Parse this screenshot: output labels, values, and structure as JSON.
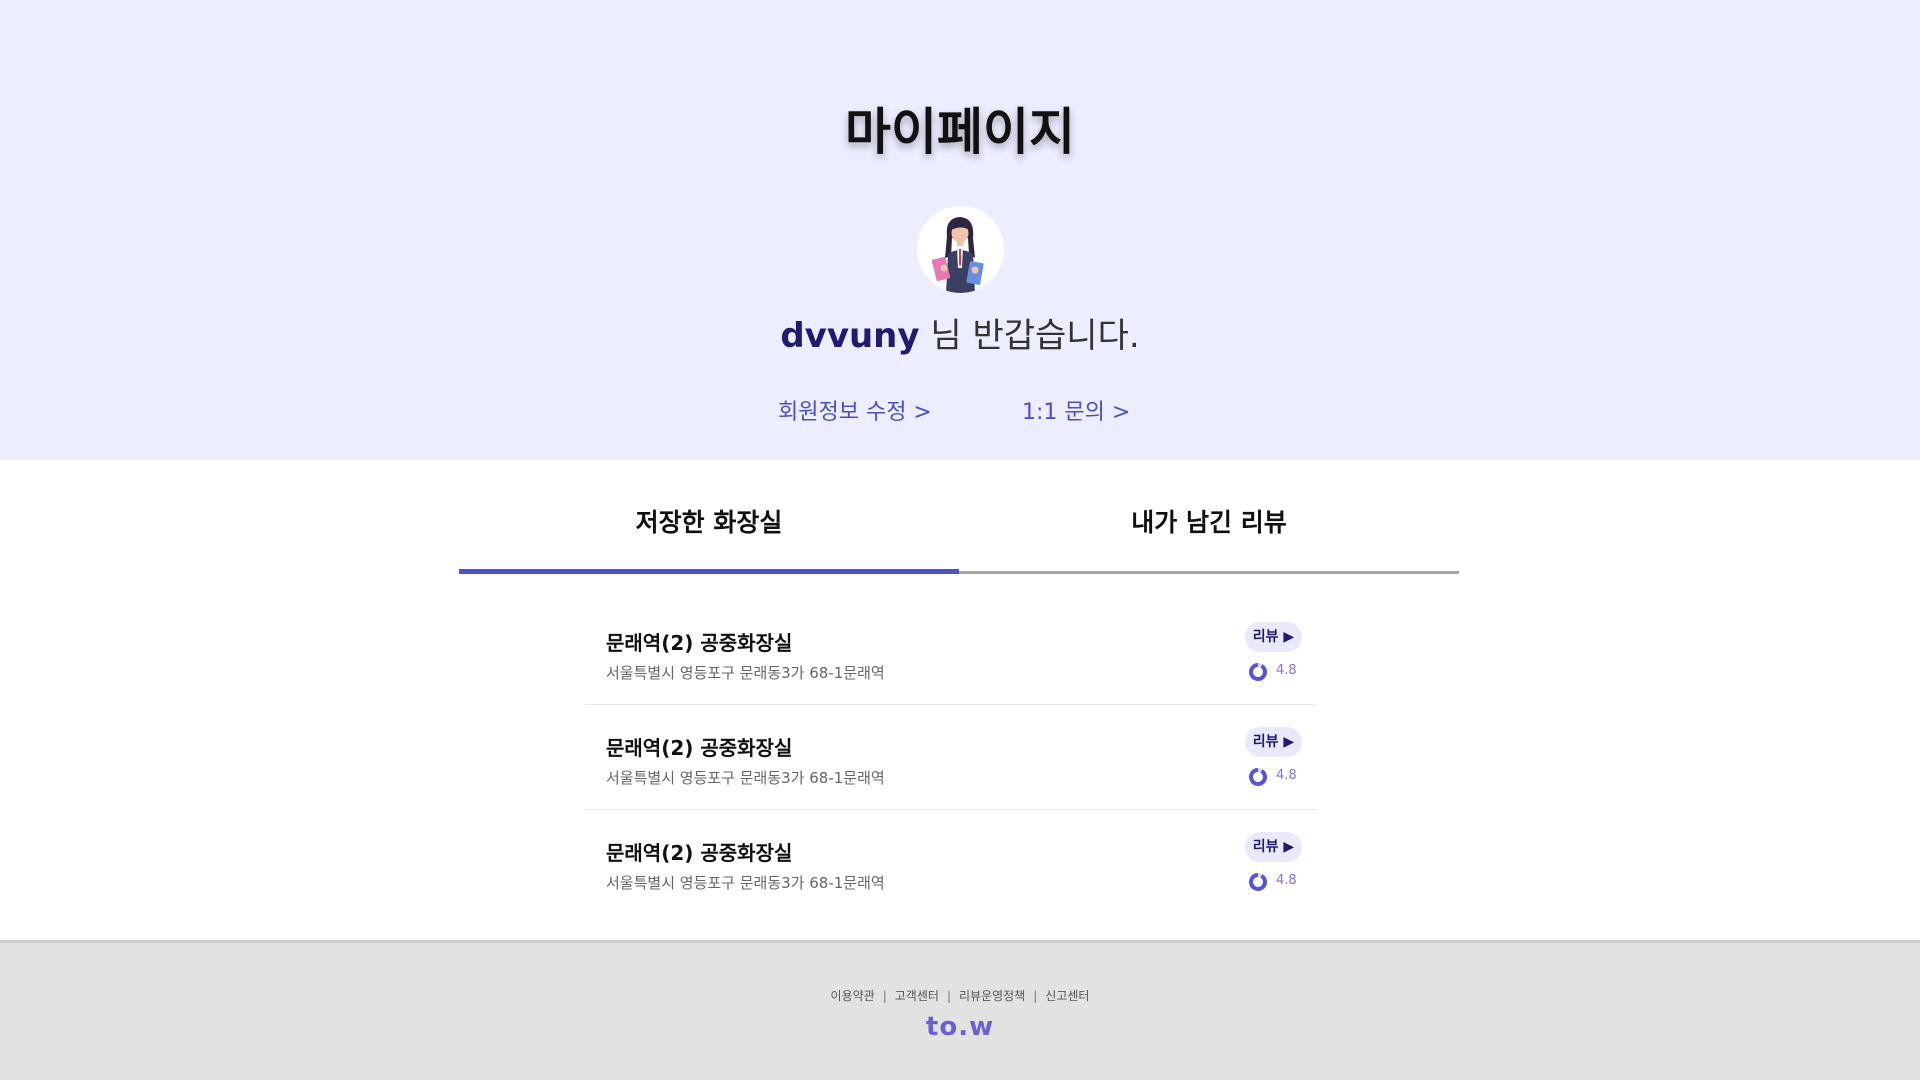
{
  "header": {
    "title": "마이페이지",
    "username": "dvvuny",
    "greeting_suffix": " 님 반갑습니다.",
    "edit_profile_link": "회원정보 수정 >",
    "inquiry_link": "1:1 문의 >"
  },
  "tabs": [
    {
      "label": "저장한 화장실",
      "active": true
    },
    {
      "label": "내가 남긴 리뷰",
      "active": false
    }
  ],
  "saved_toilets": [
    {
      "name": "문래역(2) 공중화장실",
      "address": "서울특별시 영등포구 문래동3가 68-1문래역",
      "review_label": "리뷰 ▶",
      "rating": "4.8"
    },
    {
      "name": "문래역(2) 공중화장실",
      "address": "서울특별시 영등포구 문래동3가 68-1문래역",
      "review_label": "리뷰 ▶",
      "rating": "4.8"
    },
    {
      "name": "문래역(2) 공중화장실",
      "address": "서울특별시 영등포구 문래동3가 68-1문래역",
      "review_label": "리뷰 ▶",
      "rating": "4.8"
    }
  ],
  "footer": {
    "links": [
      "이용약관",
      "고객센터",
      "리뷰운영정책",
      "신고센터"
    ],
    "separator": "|",
    "logo": "to.w"
  },
  "colors": {
    "hero_background": "#ecedfe",
    "accent": "#4d53c7",
    "username": "#1f1b6e",
    "rating": "#8a6fd6",
    "footer_background": "#e2e2e2"
  },
  "icons": [
    "avatar-illustration",
    "rating-ring-icon"
  ]
}
